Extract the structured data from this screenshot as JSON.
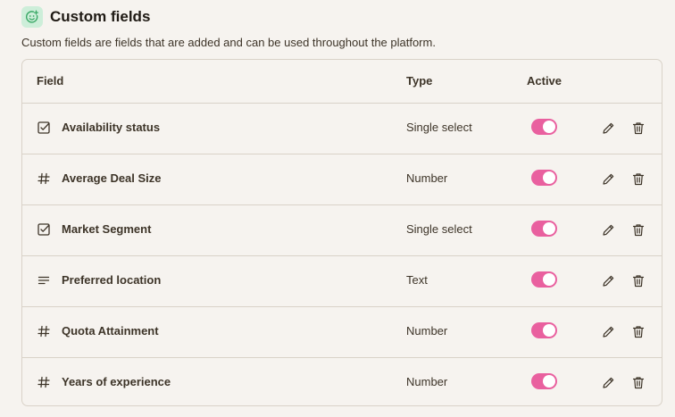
{
  "page": {
    "title": "Custom fields",
    "description": "Custom fields are fields that are added and can be used throughout the platform.",
    "header_icon": "smiley-plus-icon"
  },
  "table": {
    "columns": {
      "field": "Field",
      "type": "Type",
      "active": "Active"
    },
    "rows": [
      {
        "name": "Availability status",
        "type": "Single select",
        "icon": "checkbox-icon",
        "active": true
      },
      {
        "name": "Average Deal Size",
        "type": "Number",
        "icon": "hash-icon",
        "active": true
      },
      {
        "name": "Market Segment",
        "type": "Single select",
        "icon": "checkbox-icon",
        "active": true
      },
      {
        "name": "Preferred location",
        "type": "Text",
        "icon": "text-lines-icon",
        "active": true
      },
      {
        "name": "Quota Attainment",
        "type": "Number",
        "icon": "hash-icon",
        "active": true
      },
      {
        "name": "Years of experience",
        "type": "Number",
        "icon": "hash-icon",
        "active": true
      }
    ]
  },
  "colors": {
    "toggle_on": "#e9609f",
    "header_icon_bg": "#cdeed9",
    "header_icon_fg": "#3aa866",
    "background": "#f6f3ef"
  }
}
